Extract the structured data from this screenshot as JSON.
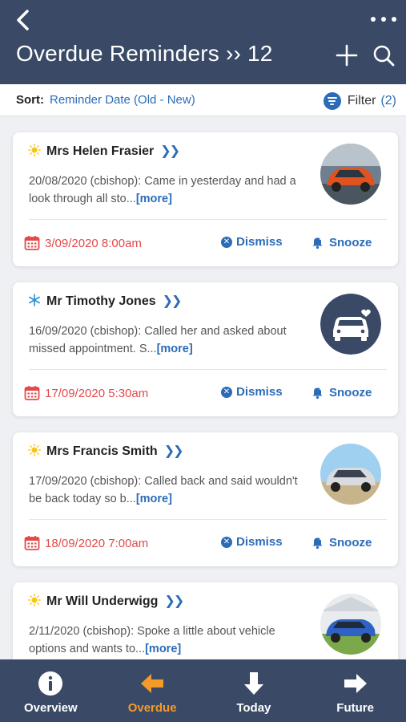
{
  "header": {
    "title": "Overdue Reminders",
    "count_sep": "››",
    "count": "12"
  },
  "sort": {
    "label": "Sort:",
    "value": "Reminder Date (Old - New)"
  },
  "filter": {
    "label": "Filter",
    "count": "(2)"
  },
  "reminders": [
    {
      "weather": "sun-icon",
      "name": "Mrs Helen Frasier",
      "note": "20/08/2020 (cbishop): Came in yesterday and had a look through all sto...",
      "more": "[more]",
      "date": "3/09/2020 8:00am",
      "dismiss": "Dismiss",
      "snooze": "Snooze"
    },
    {
      "weather": "snowflake-icon",
      "name": "Mr Timothy Jones",
      "note": "16/09/2020 (cbishop): Called her and asked about missed appointment. S...",
      "more": "[more]",
      "date": "17/09/2020 5:30am",
      "dismiss": "Dismiss",
      "snooze": "Snooze"
    },
    {
      "weather": "sun-icon",
      "name": "Mrs Francis Smith",
      "note": "17/09/2020 (cbishop): Called back and said wouldn't be back today so b...",
      "more": "[more]",
      "date": "18/09/2020 7:00am",
      "dismiss": "Dismiss",
      "snooze": "Snooze"
    },
    {
      "weather": "sun-icon",
      "name": "Mr Will Underwigg",
      "note": "2/11/2020 (cbishop): Spoke a little about vehicle options and wants to...",
      "more": "[more]",
      "date": "",
      "dismiss": "",
      "snooze": ""
    }
  ],
  "nav": {
    "tabs": [
      {
        "label": "Overview",
        "icon": "info-icon"
      },
      {
        "label": "Overdue",
        "icon": "arrow-left-icon",
        "active": true
      },
      {
        "label": "Today",
        "icon": "arrow-down-icon"
      },
      {
        "label": "Future",
        "icon": "arrow-right-icon"
      }
    ]
  },
  "colors": {
    "header_bg": "#3a4a66",
    "accent": "#2b6cb8",
    "overdue_date": "#e24a4a",
    "active_tab": "#f49a2a"
  }
}
